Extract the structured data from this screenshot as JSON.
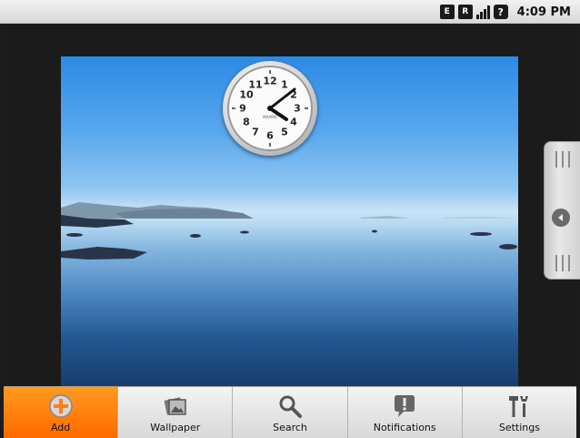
{
  "status_bar": {
    "time": "4:09 PM",
    "network_e": "E",
    "network_r": "R",
    "unknown_badge": "?"
  },
  "clock_widget": {
    "brand": "MAAMO",
    "numerals": [
      "12",
      "1",
      "2",
      "3",
      "4",
      "5",
      "6",
      "7",
      "8",
      "9",
      "10",
      "11"
    ]
  },
  "menu": {
    "items": [
      {
        "label": "Add",
        "icon": "add-icon"
      },
      {
        "label": "Wallpaper",
        "icon": "wallpaper-icon"
      },
      {
        "label": "Search",
        "icon": "search-icon"
      },
      {
        "label": "Notifications",
        "icon": "notifications-icon"
      },
      {
        "label": "Settings",
        "icon": "settings-icon"
      }
    ],
    "active_index": 0
  },
  "colors": {
    "active_menu": "#ff7a00",
    "menu_bg": "#e6e6e6"
  }
}
